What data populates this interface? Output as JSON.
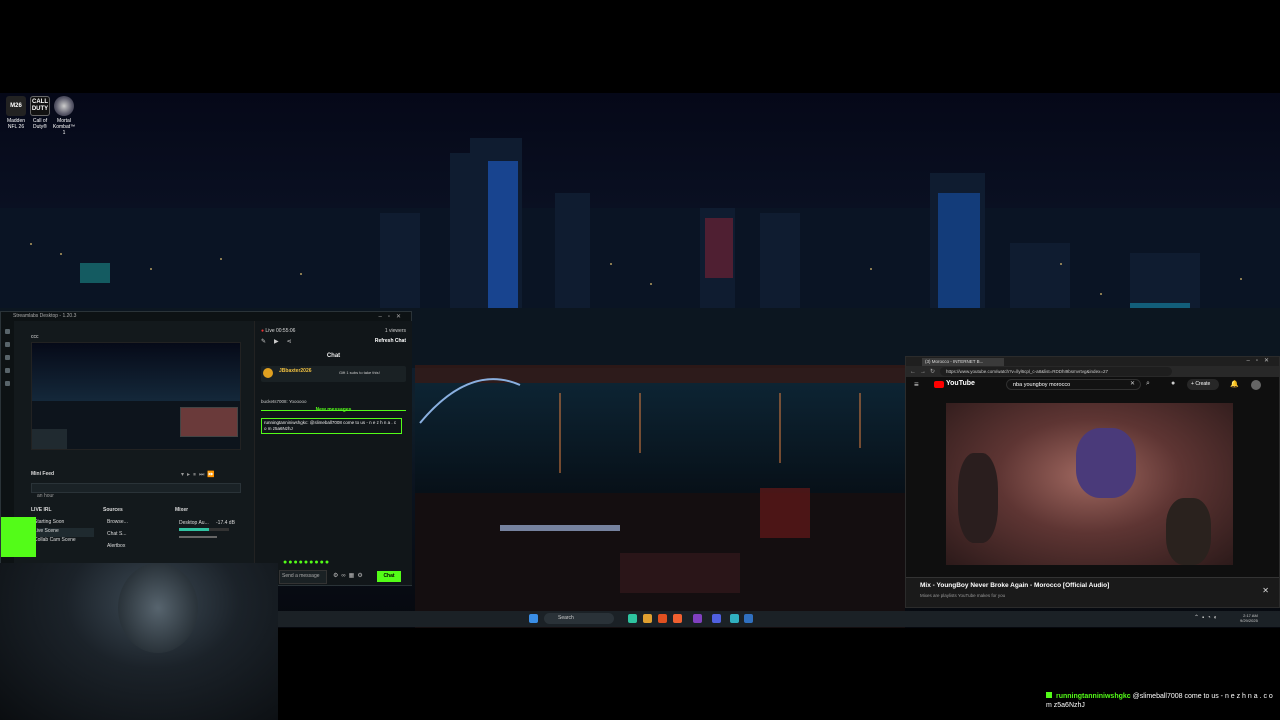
{
  "desktop_icons": [
    {
      "name": "madden-icon",
      "label": "Madden NFL 26",
      "glyph": "M26"
    },
    {
      "name": "cod-icon",
      "label": "Call of Duty®",
      "glyph": "CALL DUTY"
    },
    {
      "name": "mortal-kombat-icon",
      "label": "Mortal Kombat™ 1",
      "glyph": ""
    }
  ],
  "streamlabs": {
    "title": "Streamlabs Desktop - 1.20.3",
    "live_time": "Live 00:55:06",
    "viewers": "1 viewers",
    "refresh_chat": "Refresh Chat",
    "chat_header": "Chat",
    "gift_user": "JBbaxter2026",
    "gift_text": "Gift 1 subs to take this!",
    "chat_user_line": "buckets7008: Yoooooo",
    "new_messages": "New messages",
    "chat_highlight": "runningtanniniwshgkc: @slimeball7008 come to us - n e z h n a . c o m z5a6NzhJ",
    "send_placeholder": "Send a message",
    "chat_button": "Chat",
    "mini_feed": "Mini Feed",
    "feed_filter": "an hour",
    "scenes_title": "LIVE IRL",
    "scenes": [
      "Starting Soon",
      "Live Scene",
      "Collab Cam Scene"
    ],
    "sources_title": "Sources",
    "sources": [
      "Browse...",
      "Chat S...",
      "Alertbox"
    ],
    "mixer_title": "Mixer",
    "mixer_source": "Desktop Au...",
    "mixer_db": "-17.4 dB",
    "preview_label": "ccc"
  },
  "browser": {
    "tab_title": "(3) Morocco - INTERNET B...",
    "url": "https://www.youtube.com/watch?v=llyl6cpl_c-a8&list=RDDhI9bsmvrtvg&index=27",
    "youtube_label": "YouTube",
    "search_query": "nba youngboy morocco",
    "create_label": "Create",
    "mix_title": "Mix - YoungBoy Never Broke Again - Morocco [Official Audio]",
    "mix_subtitle": "Mixes are playlists YouTube makes for you"
  },
  "taskbar": {
    "search_label": "Search",
    "time": "2:17 AM",
    "date": "9/29/2025"
  },
  "chat_overlay": {
    "user": "runningtanniniwshgkc",
    "message": "@slimeball7008 come to us - n e z h n a . c o m z5a6NzhJ"
  },
  "colors": {
    "kick_green": "#53fc18",
    "accent": "#31c3a2"
  }
}
